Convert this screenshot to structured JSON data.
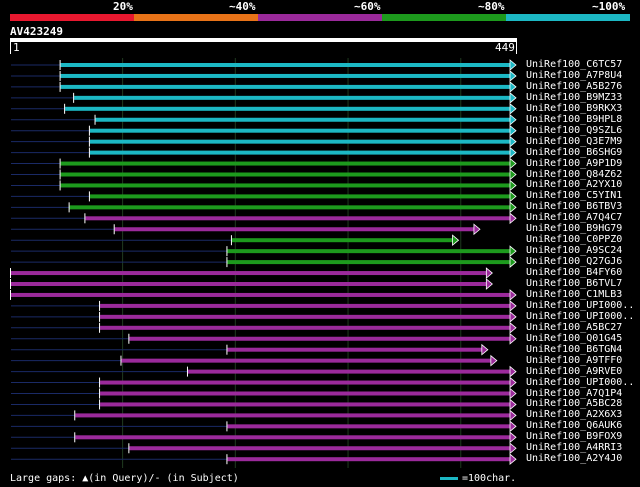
{
  "legend": {
    "labels": [
      "20%",
      "~40%",
      "~60%",
      "~80%",
      "~100%"
    ],
    "colors": [
      "#e8182f",
      "#e87318",
      "#9b2a9b",
      "#1d9a1d",
      "#1cb8c4"
    ]
  },
  "query": {
    "id": "AV423249",
    "start": "1",
    "end": "449"
  },
  "footer": {
    "gaps_label": "Large gaps: ▲(in Query)/- (in Subject)",
    "scale_label": "=100char.",
    "scale_color": "#1cb8c4"
  },
  "chart_data": {
    "type": "alignment",
    "query_length": 449,
    "hits": [
      {
        "name": "UniRef100_C6TC57",
        "start": 45,
        "end": 449,
        "identity_band": "~100%",
        "arrow": true
      },
      {
        "name": "UniRef100_A7P8U4",
        "start": 45,
        "end": 449,
        "identity_band": "~100%",
        "arrow": true
      },
      {
        "name": "UniRef100_A5B276",
        "start": 45,
        "end": 449,
        "identity_band": "~100%",
        "arrow": true
      },
      {
        "name": "UniRef100_B9MZ33",
        "start": 57,
        "end": 449,
        "identity_band": "~100%",
        "arrow": true
      },
      {
        "name": "UniRef100_B9RKX3",
        "start": 49,
        "end": 449,
        "identity_band": "~100%",
        "arrow": true
      },
      {
        "name": "UniRef100_B9HPL8",
        "start": 76,
        "end": 449,
        "identity_band": "~100%",
        "arrow": true
      },
      {
        "name": "UniRef100_Q9SZL6",
        "start": 71,
        "end": 449,
        "identity_band": "~100%",
        "arrow": true
      },
      {
        "name": "UniRef100_Q3E7M9",
        "start": 71,
        "end": 449,
        "identity_band": "~100%",
        "arrow": true
      },
      {
        "name": "UniRef100_B6SHG9",
        "start": 71,
        "end": 449,
        "identity_band": "~100%",
        "arrow": true
      },
      {
        "name": "UniRef100_A9P1D9",
        "start": 45,
        "end": 449,
        "identity_band": "~80%",
        "arrow": true
      },
      {
        "name": "UniRef100_Q84Z62",
        "start": 45,
        "end": 449,
        "identity_band": "~80%",
        "arrow": true
      },
      {
        "name": "UniRef100_A2YX10",
        "start": 45,
        "end": 449,
        "identity_band": "~80%",
        "arrow": true
      },
      {
        "name": "UniRef100_C5YIN1",
        "start": 71,
        "end": 449,
        "identity_band": "~80%",
        "arrow": true
      },
      {
        "name": "UniRef100_B6TBV3",
        "start": 53,
        "end": 449,
        "identity_band": "~80%",
        "arrow": true
      },
      {
        "name": "UniRef100_A7Q4C7",
        "start": 67,
        "end": 449,
        "identity_band": "~60%",
        "arrow": true
      },
      {
        "name": "UniRef100_B9HG79",
        "start": 93,
        "end": 417,
        "identity_band": "~60%",
        "arrow": true
      },
      {
        "name": "UniRef100_C0PPZ0",
        "start": 197,
        "end": 398,
        "identity_band": "~80%",
        "arrow": true
      },
      {
        "name": "UniRef100_A9SC24",
        "start": 193,
        "end": 449,
        "identity_band": "~80%",
        "arrow": true
      },
      {
        "name": "UniRef100_Q27GJ6",
        "start": 193,
        "end": 449,
        "identity_band": "~80%",
        "arrow": true
      },
      {
        "name": "UniRef100_B4FY60",
        "start": 1,
        "end": 428,
        "identity_band": "~60%",
        "arrow": true
      },
      {
        "name": "UniRef100_B6TVL7",
        "start": 1,
        "end": 428,
        "identity_band": "~60%",
        "arrow": true
      },
      {
        "name": "UniRef100_C1MLB3",
        "start": 1,
        "end": 449,
        "identity_band": "~60%",
        "arrow": true
      },
      {
        "name": "UniRef100_UPI000..",
        "start": 80,
        "end": 449,
        "identity_band": "~60%",
        "arrow": true
      },
      {
        "name": "UniRef100_UPI000..",
        "start": 80,
        "end": 449,
        "identity_band": "~60%",
        "arrow": true
      },
      {
        "name": "UniRef100_A5BC27",
        "start": 80,
        "end": 449,
        "identity_band": "~60%",
        "arrow": true
      },
      {
        "name": "UniRef100_Q01G45",
        "start": 106,
        "end": 449,
        "identity_band": "~60%",
        "arrow": true
      },
      {
        "name": "UniRef100_B6TGN4",
        "start": 193,
        "end": 424,
        "identity_band": "~60%",
        "arrow": true
      },
      {
        "name": "UniRef100_A9TFF0",
        "start": 99,
        "end": 432,
        "identity_band": "~60%",
        "arrow": true
      },
      {
        "name": "UniRef100_A9RVE0",
        "start": 158,
        "end": 449,
        "identity_band": "~60%",
        "arrow": true
      },
      {
        "name": "UniRef100_UPI000..",
        "start": 80,
        "end": 449,
        "identity_band": "~60%",
        "arrow": true
      },
      {
        "name": "UniRef100_A7Q1P4",
        "start": 80,
        "end": 449,
        "identity_band": "~60%",
        "arrow": true
      },
      {
        "name": "UniRef100_A5BC28",
        "start": 80,
        "end": 449,
        "identity_band": "~60%",
        "arrow": true
      },
      {
        "name": "UniRef100_A2X6X3",
        "start": 58,
        "end": 449,
        "identity_band": "~60%",
        "arrow": true
      },
      {
        "name": "UniRef100_Q6AUK6",
        "start": 193,
        "end": 449,
        "identity_band": "~60%",
        "arrow": true
      },
      {
        "name": "UniRef100_B9FOX9",
        "start": 58,
        "end": 449,
        "identity_band": "~60%",
        "arrow": true
      },
      {
        "name": "UniRef100_A4RRI3",
        "start": 106,
        "end": 449,
        "identity_band": "~60%",
        "arrow": true
      },
      {
        "name": "UniRef100_A2Y4J0",
        "start": 193,
        "end": 449,
        "identity_band": "~60%",
        "arrow": true
      }
    ]
  }
}
